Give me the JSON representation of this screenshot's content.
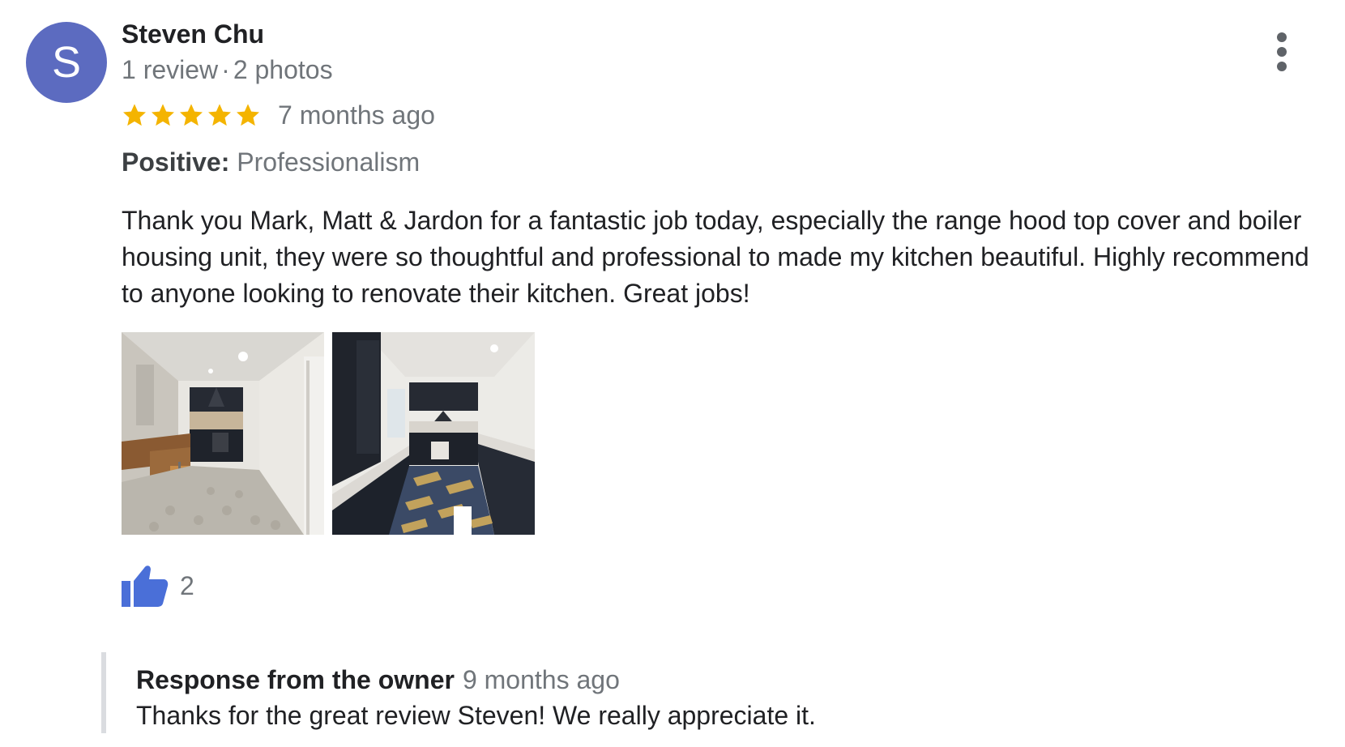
{
  "review": {
    "avatar_initial": "S",
    "avatar_color": "#5c6bc0",
    "reviewer_name": "Steven Chu",
    "review_count": "1 review",
    "separator": "·",
    "photo_count": "2 photos",
    "rating": 5,
    "rating_max": 5,
    "star_color": "#f4b400",
    "time_ago": "7 months ago",
    "highlight_label": "Positive:",
    "highlight_value": "Professionalism",
    "text": "Thank you Mark, Matt & Jardon for a fantastic job today, especially the range hood top cover and boiler housing unit, they were so thoughtful and professional to made my kitchen beautiful. Highly recommend to anyone looking to renovate their kitchen. Great jobs!",
    "photos": [
      "kitchen-photo-1",
      "kitchen-photo-2"
    ],
    "like_count": "2",
    "like_color": "#4a6fd8"
  },
  "owner_response": {
    "title": "Response from the owner",
    "time_ago": "9 months ago",
    "text": "Thanks for the great review Steven! We really appreciate it."
  },
  "icons": {
    "more": "more-vert-icon",
    "star": "star-icon",
    "like": "thumbs-up-icon"
  }
}
